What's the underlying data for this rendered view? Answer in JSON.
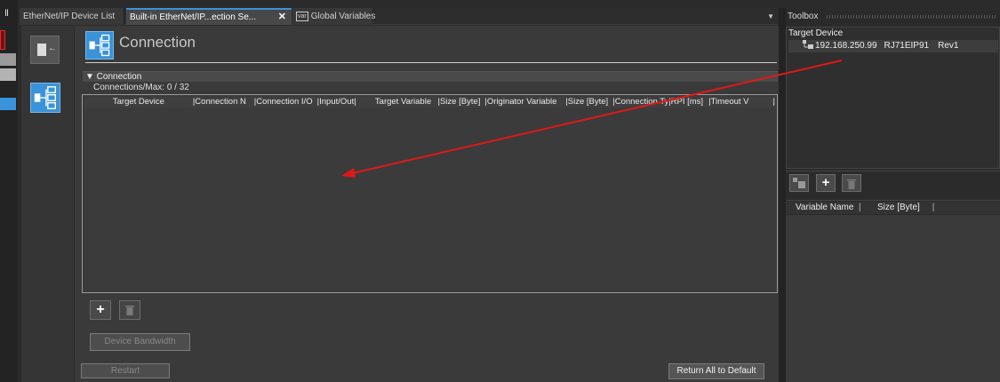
{
  "tabs": [
    {
      "label": "EtherNet/IP Device List"
    },
    {
      "label": "Built-in EtherNet/IP...ection Se...",
      "close": "✕"
    },
    {
      "label": "Global Variables",
      "icon_text": "var"
    }
  ],
  "header": {
    "title": "Connection"
  },
  "section": {
    "title": "▼ Connection",
    "count_text": "Connections/Max: 0 / 32",
    "columns": [
      "Target Device",
      "|Connection N",
      "|Connection I/O",
      "|Input/Out|",
      "Target Variable",
      "|Size [Byte]",
      "|Originator Variable",
      "|Size [Byte]",
      "|Connection Ty",
      "|RPI [ms]",
      "|Timeout V",
      "|"
    ]
  },
  "buttons": {
    "add": "+",
    "bandwidth": "Device Bandwidth",
    "restart": "Restart",
    "return_default": "Return All to Default"
  },
  "toolbox": {
    "title": "Toolbox",
    "target_label": "Target Device",
    "device": {
      "ip": "192.168.250.99",
      "model": "RJ71EIP91",
      "rev": "Rev1"
    },
    "add": "+",
    "var_columns": [
      "Variable Name",
      "Size [Byte]"
    ]
  },
  "colors": {
    "accent": "#3a93d8",
    "annotation_arrow": "#e01818",
    "background": "#2b2b2b"
  },
  "icons": [
    "pin-icon",
    "device-icon",
    "connection-icon",
    "close-icon",
    "dropdown-icon",
    "add-icon",
    "delete-icon",
    "tree-device-icon",
    "var-icon"
  ]
}
